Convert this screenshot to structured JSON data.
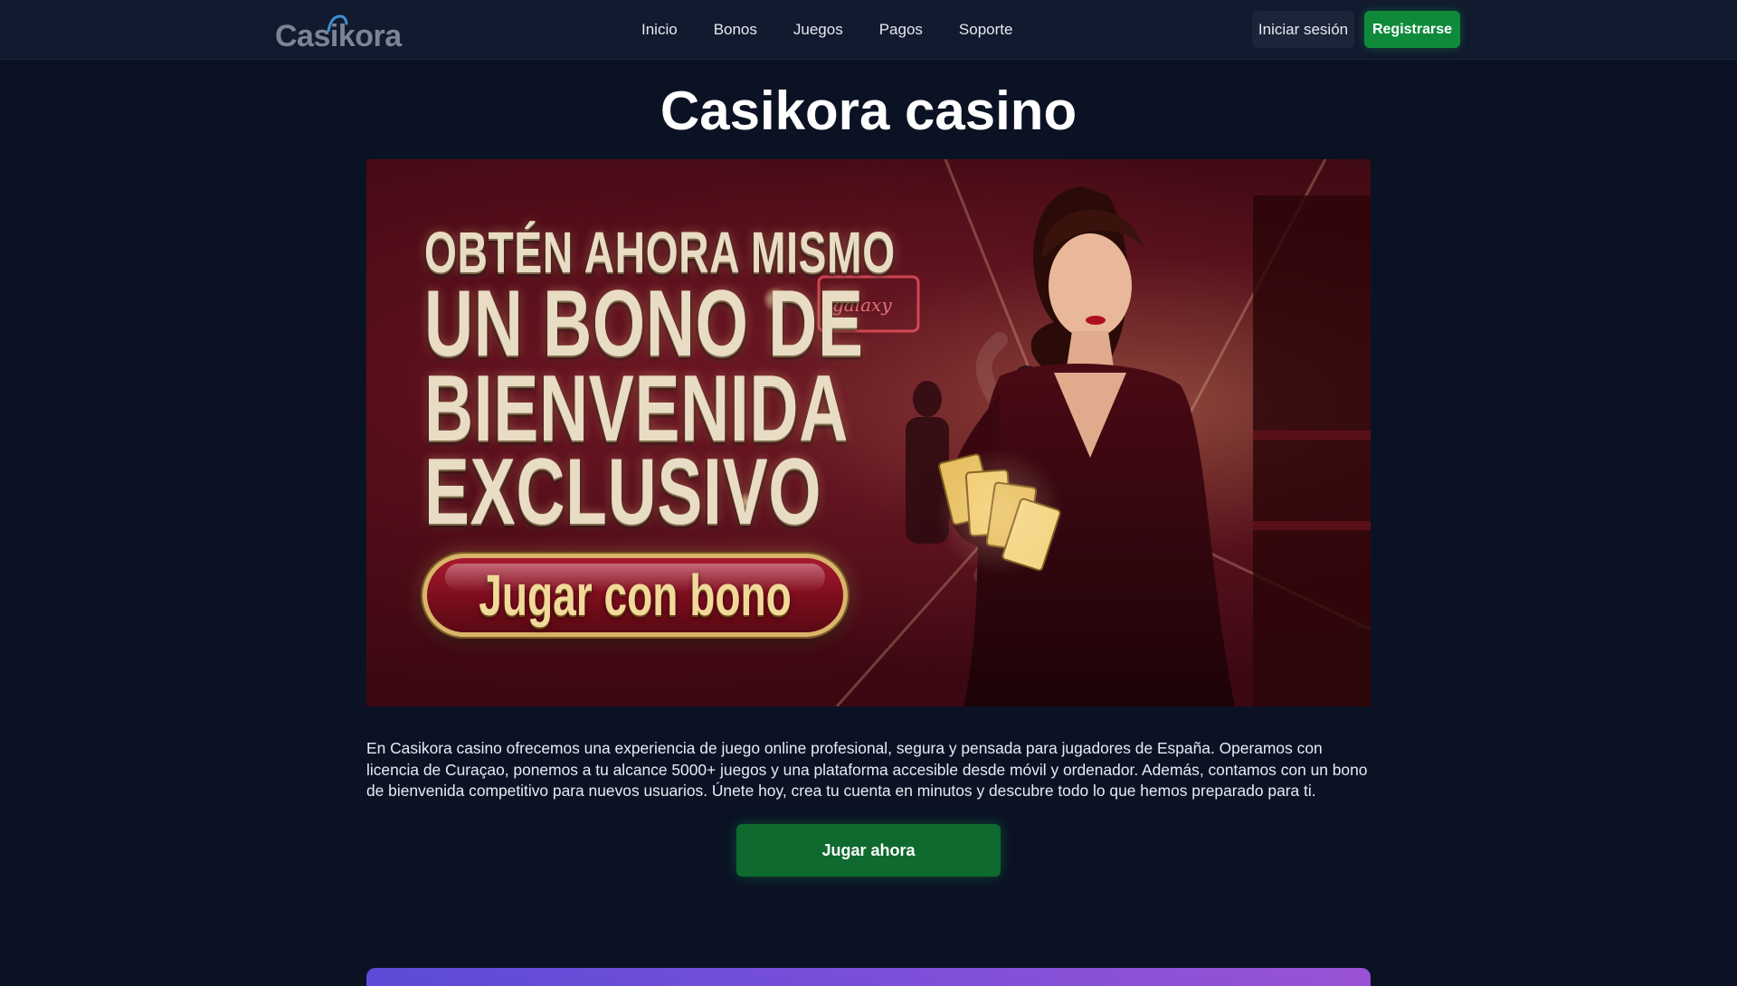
{
  "header": {
    "logo_text": "Casikora",
    "nav": [
      {
        "label": "Inicio"
      },
      {
        "label": "Bonos"
      },
      {
        "label": "Juegos"
      },
      {
        "label": "Pagos"
      },
      {
        "label": "Soporte"
      }
    ],
    "login_label": "Iniciar sesión",
    "register_label": "Registrarse"
  },
  "main": {
    "title": "Casikora casino",
    "banner": {
      "line1": "OBTÉN AHORA MISMO",
      "line2": "UN BONO DE",
      "line3": "BIENVENIDA",
      "line4": "EXCLUSIVO",
      "cta_label": "Jugar con bono",
      "neon_sign": "galaxy"
    },
    "description": "En Casikora casino ofrecemos una experiencia de juego online profesional, segura y pensada para jugadores de España. Operamos con licencia de Curaçao, ponemos a tu alcance 5000+ juegos y una plataforma accesible desde móvil y ordenador. Además, contamos con un bono de bienvenida competitivo para nuevos usuarios. Únete hoy, crea tu cuenta en minutos y descubre todo lo que hemos preparado para ti.",
    "play_label": "Jugar ahora"
  },
  "colors": {
    "page_bg": "#0b1224",
    "header_bg": "#111a2e",
    "accent_green": "#0f8a3a",
    "gold": "#e9dcc4",
    "banner_red": "#7a0d1c"
  }
}
